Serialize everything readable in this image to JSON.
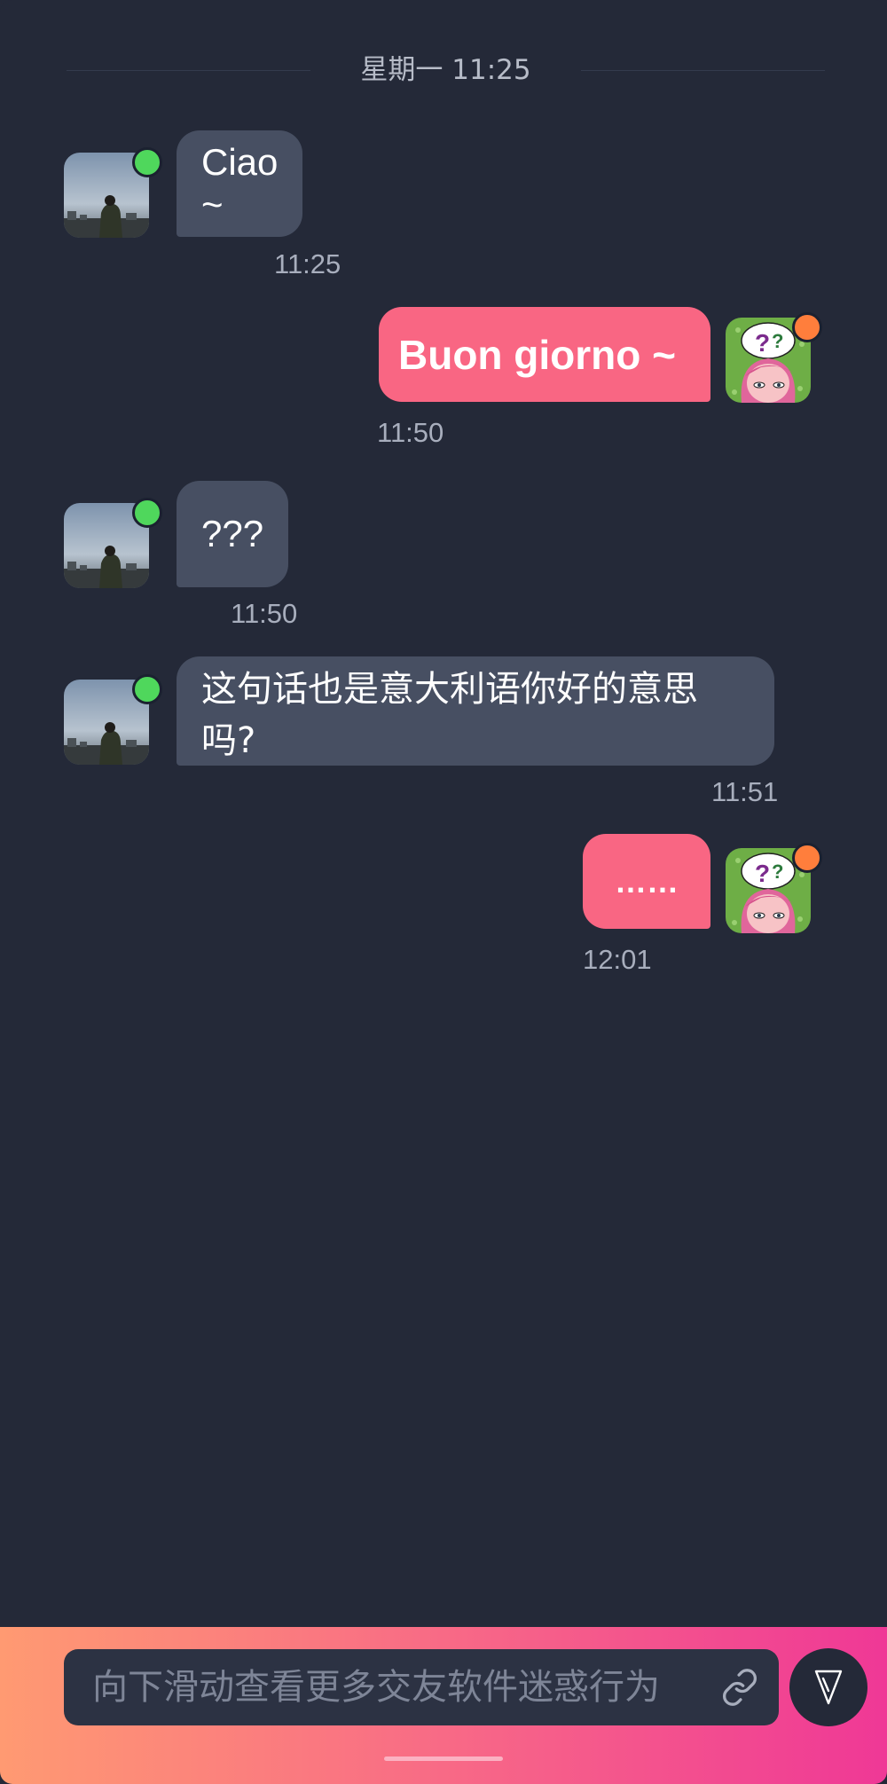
{
  "date_header": "星期一 11:25",
  "messages": [
    {
      "side": "in",
      "text": "Ciao ~",
      "time": "11:25",
      "status": "online"
    },
    {
      "side": "out",
      "text": "Buon giorno ~",
      "time": "11:50",
      "status": "away"
    },
    {
      "side": "in",
      "text": "???",
      "time": "11:50",
      "status": "online"
    },
    {
      "side": "in",
      "text": "这句话也是意大利语你好的意思吗?",
      "time": "11:51",
      "status": "online"
    },
    {
      "side": "out",
      "text": "……",
      "time": "12:01",
      "status": "away"
    }
  ],
  "composer": {
    "placeholder": "向下滑动查看更多交友软件迷惑行为",
    "attach_icon": "link-icon",
    "send_icon": "send-arrow-icon"
  },
  "colors": {
    "background": "#242938",
    "incoming_bubble": "#474f62",
    "outgoing_bubble": "#f96683",
    "online_dot": "#4fd75c",
    "away_dot": "#ff7e3c"
  }
}
